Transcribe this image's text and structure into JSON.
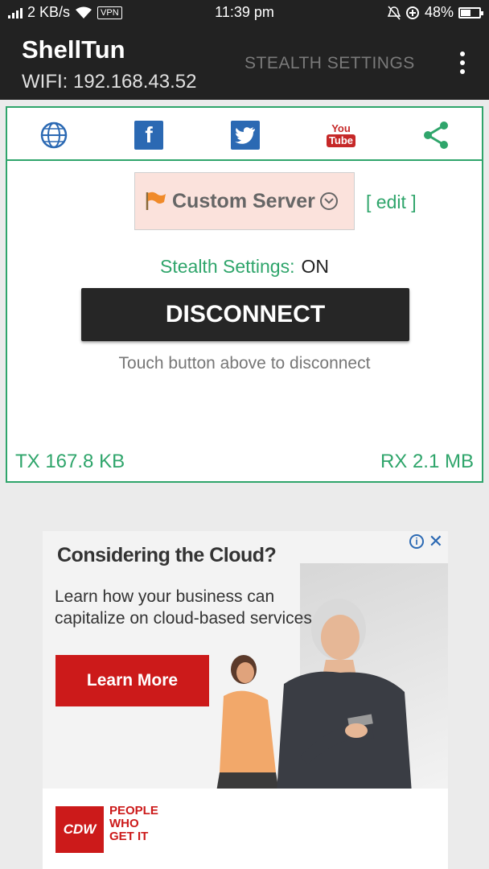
{
  "status_bar": {
    "speed": "2 KB/s",
    "vpn": "VPN",
    "time": "11:39 pm",
    "battery": "48%",
    "battery_level": 0.48,
    "icons": [
      "signal-icon",
      "wifi-icon",
      "vpn-icon",
      "alarm-off-icon",
      "data-saver-icon",
      "battery-icon"
    ]
  },
  "app_bar": {
    "title": "ShellTun",
    "subtitle": "WIFI: 192.168.43.52",
    "stealth_settings_label": "STEALTH SETTINGS",
    "overflow_icon": "more-vert-icon"
  },
  "social_icons": [
    "globe-icon",
    "facebook-icon",
    "twitter-icon",
    "youtube-icon",
    "share-icon"
  ],
  "youtube_text": {
    "top": "You",
    "bottom": "Tube"
  },
  "facebook_glyph": "f",
  "server": {
    "label": "Custom Server",
    "edit_label": "[ edit ]"
  },
  "stealth": {
    "label": "Stealth Settings:",
    "value": "ON"
  },
  "disconnect_label": "DISCONNECT",
  "hint": "Touch button above to disconnect",
  "traffic": {
    "tx": "TX 167.8 KB",
    "rx": "RX 2.1 MB"
  },
  "ad": {
    "headline": "Considering the Cloud?",
    "body": "Learn how your business can capitalize on cloud-based services",
    "cta": "Learn More",
    "brand": "CDW",
    "tagline_1": "PEOPLE",
    "tagline_2": "WHO",
    "tagline_3": "GET IT",
    "info_glyph": "i",
    "close_glyph": "✕"
  },
  "colors": {
    "accent": "#2fa56b",
    "dark": "#222222",
    "ad_red": "#cc1a1a",
    "link_blue": "#2b69b3"
  }
}
